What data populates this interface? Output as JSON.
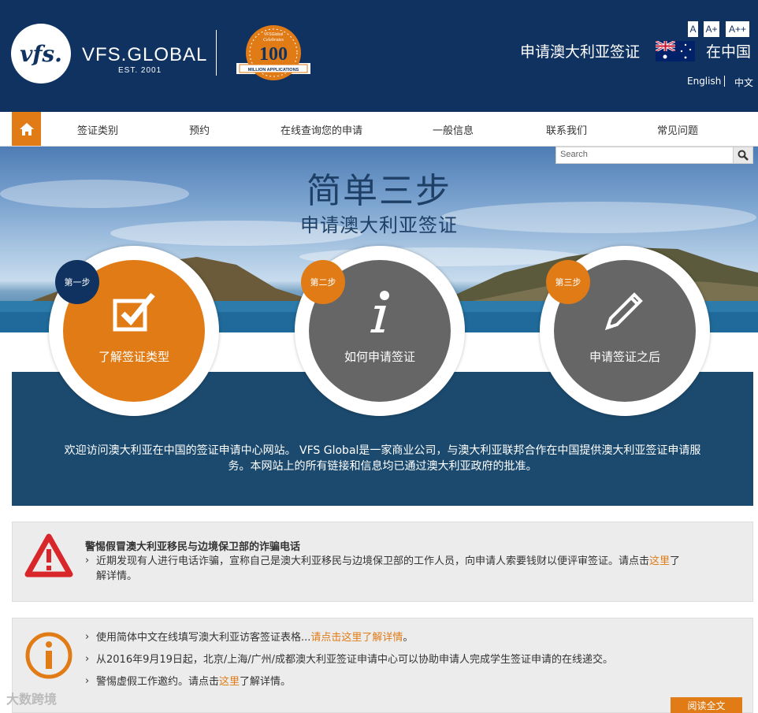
{
  "header": {
    "logo_text": "vfs.",
    "brand": "VFS.GLOBAL",
    "est": "EST. 2001",
    "badge": {
      "line1": "VFSGlobal",
      "line2": "Celebrates",
      "number": "100",
      "line3": "MILLION APPLICATIONS"
    },
    "font_sizes": [
      "A",
      "A+",
      "A++"
    ],
    "title": "申请澳大利亚签证",
    "location": "在中国",
    "languages": [
      "English",
      "中文"
    ]
  },
  "nav": {
    "items": [
      "签证类别",
      "预约",
      "在线查询您的申请",
      "一般信息",
      "联系我们",
      "常见问题"
    ]
  },
  "search": {
    "placeholder": "Search"
  },
  "hero": {
    "title": "简单三步",
    "subtitle": "申请澳大利亚签证"
  },
  "steps": [
    {
      "badge": "第一步",
      "label": "了解签证类型",
      "icon": "checkbox-icon"
    },
    {
      "badge": "第二步",
      "label": "如何申请签证",
      "icon": "info-icon"
    },
    {
      "badge": "第三步",
      "label": "申请签证之后",
      "icon": "pencil-icon"
    }
  ],
  "intro": "欢迎访问澳大利亚在中国的签证申请中心网站。 VFS Global是一家商业公司，与澳大利亚联邦合作在中国提供澳大利亚签证申请服务。本网站上的所有链接和信息均已通过澳大利亚政府的批准。",
  "alert1": {
    "title": "警惕假冒澳大利亚移民与边境保卫部的诈骗电话",
    "text_before": "近期发现有人进行电话诈骗，宣称自己是澳大利亚移民与边境保卫部的工作人员，向申请人索要钱财以便评审签证。请点击",
    "link": "这里",
    "text_after": "了解详情。"
  },
  "alert2": {
    "line1_before": "使用简体中文在线填写澳大利亚访客签证表格...",
    "line1_link": "请点击这里了解详情",
    "line1_after": "。",
    "line2": "从2016年9月19日起，北京/上海/广州/成都澳大利亚签证申请中心可以协助申请人完成学生签证申请的在线递交。",
    "line3_before": "警惕虚假工作邀约。请点击",
    "line3_link": "这里",
    "line3_after": "了解详情。",
    "read_more": "阅读全文"
  },
  "watermark": "大数跨境",
  "colors": {
    "navy": "#0f3260",
    "orange": "#e07b16",
    "panel": "#1b4a6e",
    "gray_circle": "#666666",
    "alert_red": "#d9262a"
  }
}
